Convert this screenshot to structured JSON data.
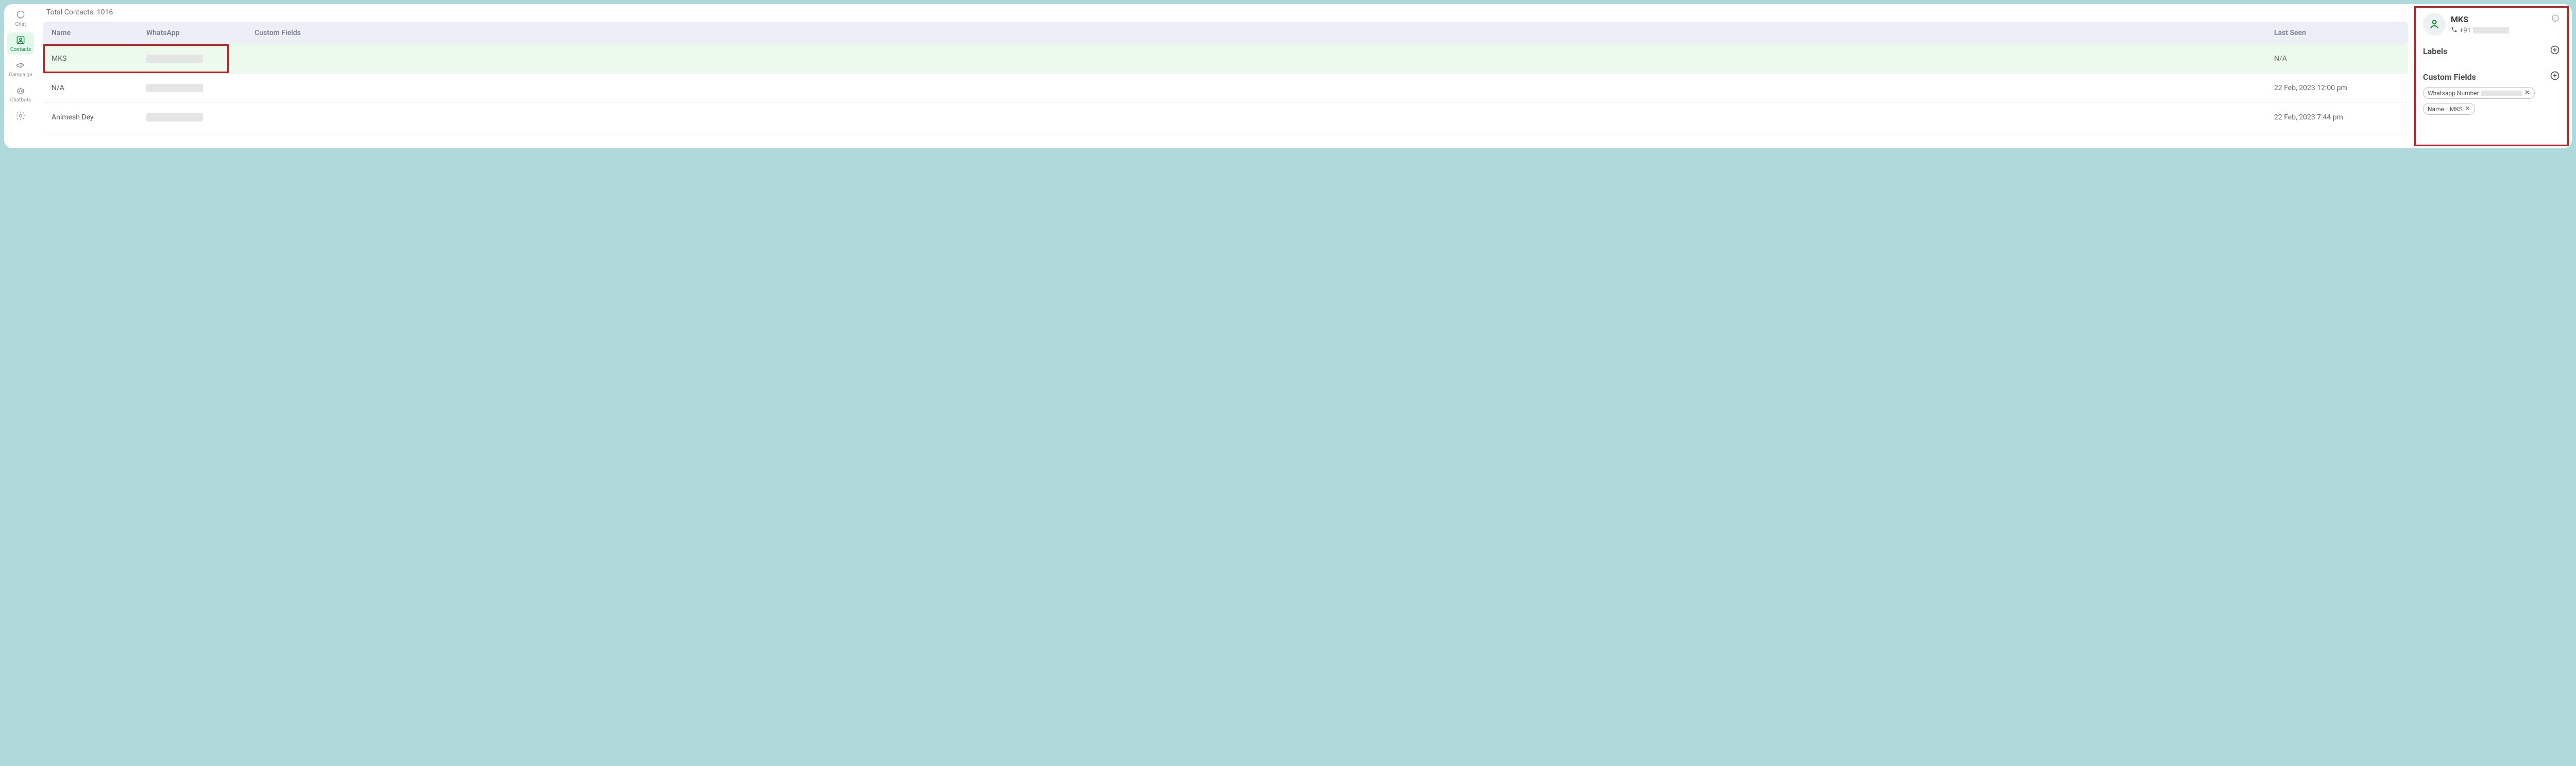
{
  "sidebar": {
    "items": [
      {
        "label": "Chat"
      },
      {
        "label": "Contacts"
      },
      {
        "label": "Campaign"
      },
      {
        "label": "Chatbots"
      }
    ]
  },
  "main": {
    "total_contacts_label": "Total Contacts: 1016",
    "columns": {
      "name": "Name",
      "whatsapp": "WhatsApp",
      "custom_fields": "Custom Fields",
      "last_seen": "Last Seen"
    },
    "rows": [
      {
        "name": "MKS",
        "last_seen": "N/A"
      },
      {
        "name": "N/A",
        "last_seen": "22 Feb, 2023 12:00 pm"
      },
      {
        "name": "Animesh Dey",
        "last_seen": "22 Feb, 2023 7:44 pm"
      }
    ]
  },
  "details": {
    "name": "MKS",
    "phone_prefix": "+91",
    "labels_title": "Labels",
    "custom_fields_title": "Custom Fields",
    "chips": {
      "whatsapp_label": "Whatsapp Number",
      "name_label": "Name",
      "name_value": "MKS"
    }
  }
}
